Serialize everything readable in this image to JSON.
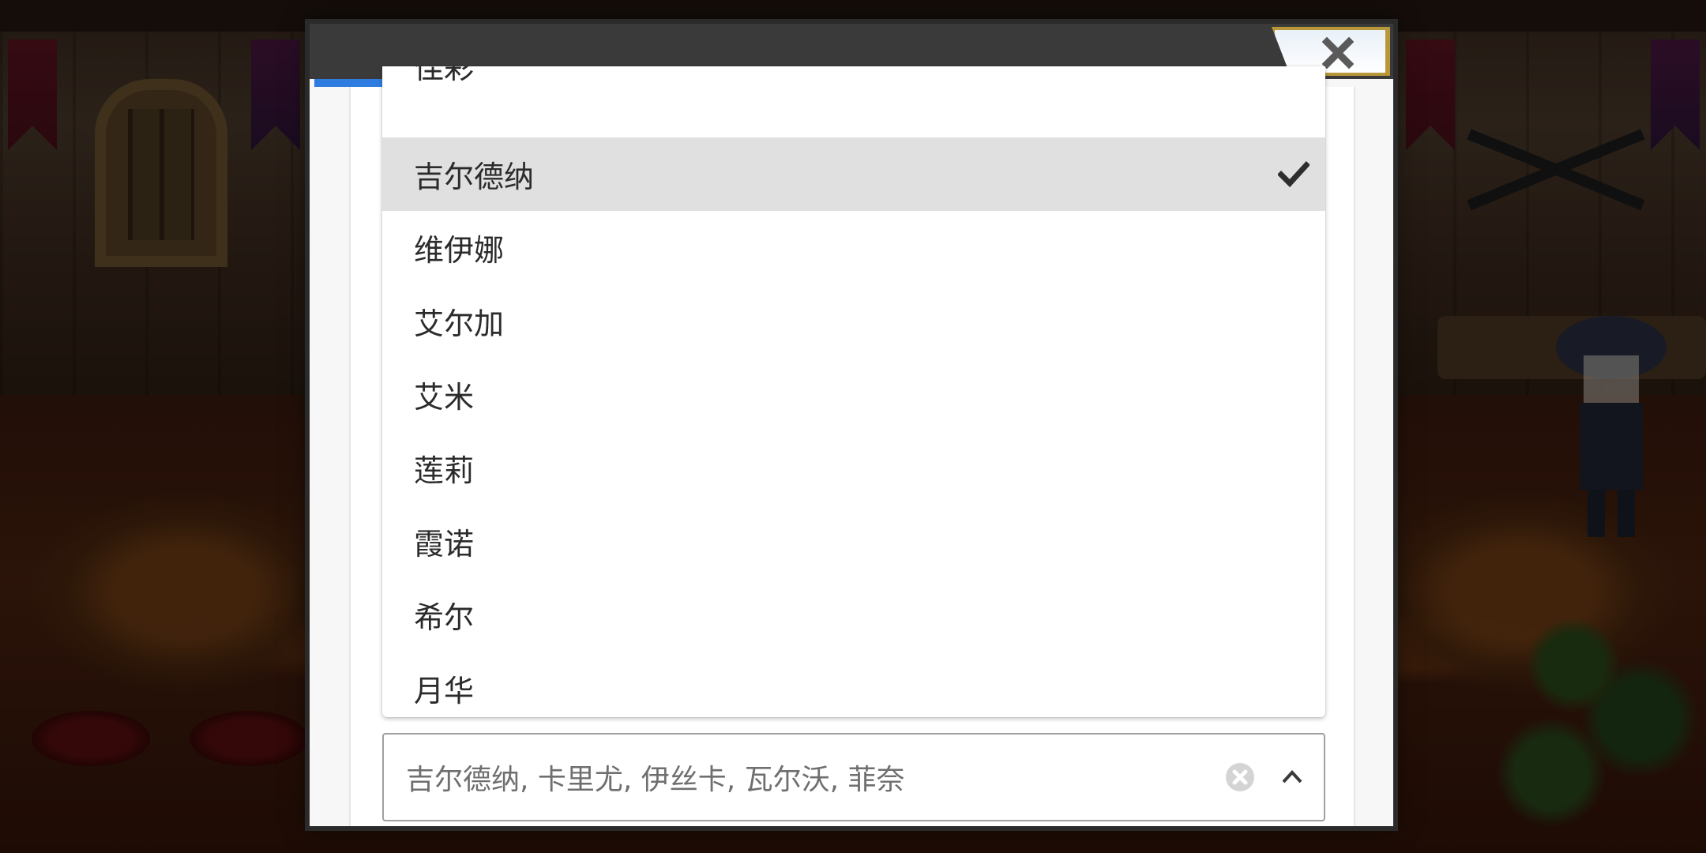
{
  "dialog": {
    "progress_fraction": 0.4,
    "close_icon": "close-icon",
    "accent_color": "#2f7ce0"
  },
  "dropdown": {
    "partial_top_label": "佳彩",
    "options": [
      {
        "label": "吉尔德纳",
        "selected": true
      },
      {
        "label": "维伊娜",
        "selected": false
      },
      {
        "label": "艾尔加",
        "selected": false
      },
      {
        "label": "艾米",
        "selected": false
      },
      {
        "label": "莲莉",
        "selected": false
      },
      {
        "label": "霞诺",
        "selected": false
      },
      {
        "label": "希尔",
        "selected": false
      },
      {
        "label": "月华",
        "selected": false
      }
    ],
    "selected_icon": "check-icon"
  },
  "select": {
    "value": "吉尔德纳, 卡里尤, 伊丝卡, 瓦尔沃, 菲奈",
    "clear_icon": "clear-icon",
    "toggle_icon": "chevron-up-icon"
  }
}
